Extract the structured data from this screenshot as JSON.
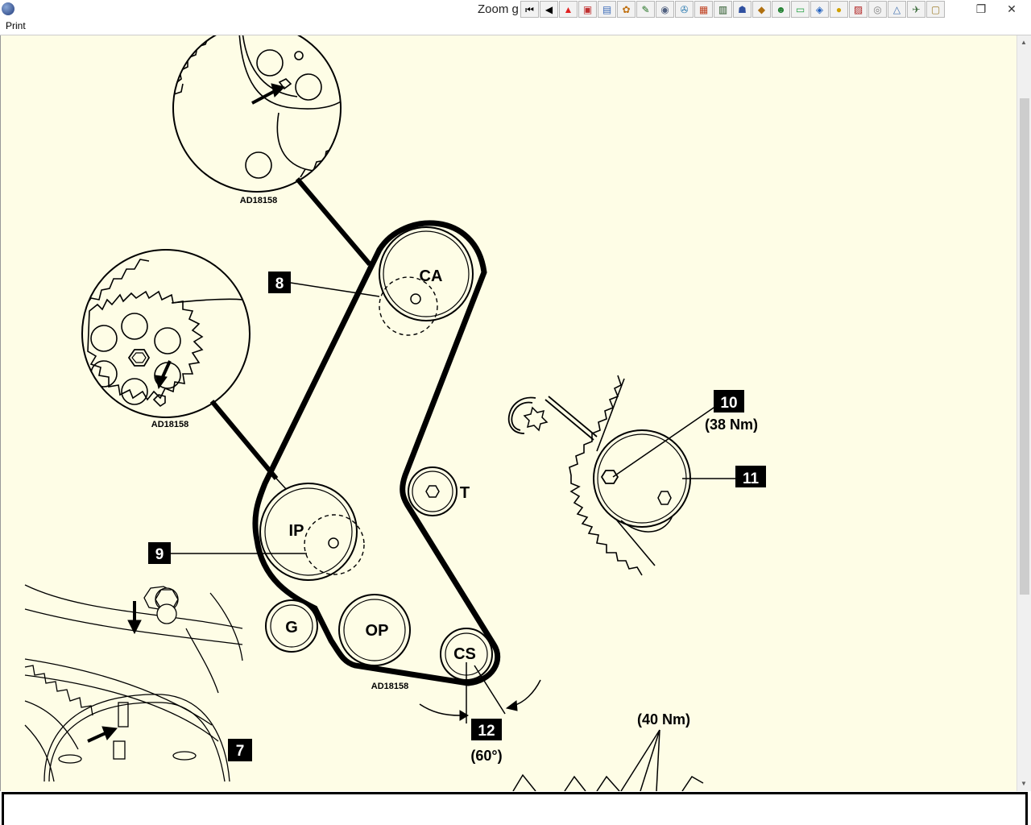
{
  "window": {
    "title": "Zoom g",
    "menu_print": "Print",
    "restore_glyph": "❐",
    "close_glyph": "✕"
  },
  "toolbar": [
    {
      "name": "first-page-button",
      "glyph": "⏮",
      "color": "#000"
    },
    {
      "name": "previous-page-button",
      "glyph": "◀",
      "color": "#000"
    },
    {
      "name": "warning-button",
      "glyph": "▲",
      "color": "#e02020"
    },
    {
      "name": "tool-button-4",
      "glyph": "▣",
      "color": "#c03030"
    },
    {
      "name": "tool-button-5",
      "glyph": "▤",
      "color": "#3a6ab8"
    },
    {
      "name": "tool-button-6",
      "glyph": "✿",
      "color": "#c07010"
    },
    {
      "name": "tool-button-7",
      "glyph": "✎",
      "color": "#207020"
    },
    {
      "name": "tool-button-8",
      "glyph": "◉",
      "color": "#506080"
    },
    {
      "name": "tool-button-9",
      "glyph": "✇",
      "color": "#2a7ab0"
    },
    {
      "name": "tool-button-10",
      "glyph": "▦",
      "color": "#c04020"
    },
    {
      "name": "tool-button-11",
      "glyph": "▥",
      "color": "#205020"
    },
    {
      "name": "tool-button-12",
      "glyph": "☗",
      "color": "#3050a0"
    },
    {
      "name": "tool-button-13",
      "glyph": "◆",
      "color": "#b07010"
    },
    {
      "name": "tool-button-14",
      "glyph": "☻",
      "color": "#208030"
    },
    {
      "name": "tool-button-15",
      "glyph": "▭",
      "color": "#20a040"
    },
    {
      "name": "tool-button-16",
      "glyph": "◈",
      "color": "#2060c0"
    },
    {
      "name": "tool-button-17",
      "glyph": "●",
      "color": "#d0a000"
    },
    {
      "name": "tool-button-18",
      "glyph": "▨",
      "color": "#b02020"
    },
    {
      "name": "tool-button-19",
      "glyph": "◎",
      "color": "#808080"
    },
    {
      "name": "tool-button-20",
      "glyph": "△",
      "color": "#4070b0"
    },
    {
      "name": "tool-button-21",
      "glyph": "✈",
      "color": "#407040"
    },
    {
      "name": "tool-button-22",
      "glyph": "▢",
      "color": "#a08030"
    }
  ],
  "diagram": {
    "ref_code": "AD18158",
    "pulleys": {
      "camshaft": "CA",
      "tensioner": "T",
      "injection_pump": "IP",
      "guide": "G",
      "oil_pump": "OP",
      "crankshaft": "CS"
    },
    "callouts": {
      "c7": "7",
      "c8": "8",
      "c9": "9",
      "c10": "10",
      "c11": "11",
      "c12": "12"
    },
    "torque_10": "(38 Nm)",
    "torque_40": "(40 Nm)",
    "angle_12": "(60°)"
  },
  "colors": {
    "viewport_bg": "#fefde6",
    "ink": "#000000"
  }
}
